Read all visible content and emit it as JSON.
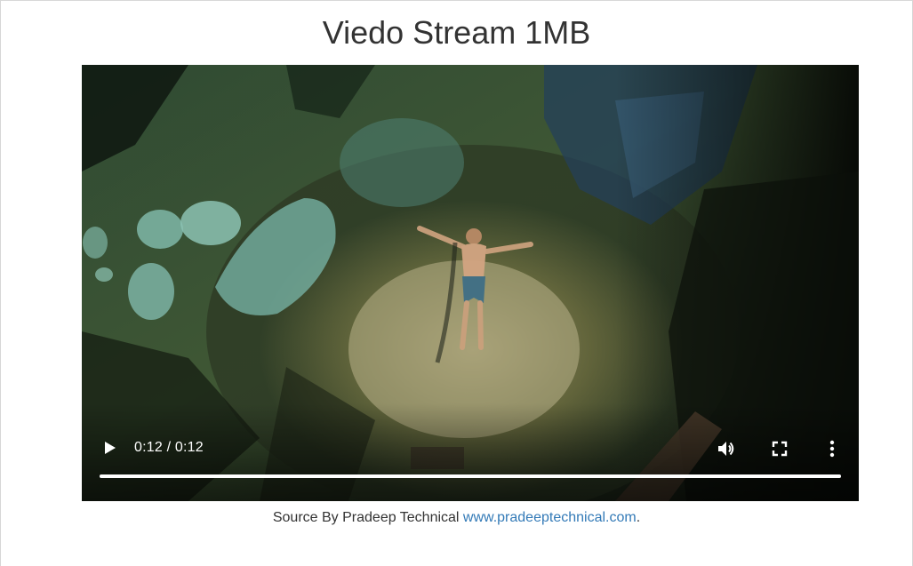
{
  "page": {
    "title": "Viedo Stream 1MB"
  },
  "video": {
    "current_time": "0:12",
    "separator": " / ",
    "duration": "0:12",
    "progress_fraction": 1.0,
    "controls": {
      "play_icon": "play-icon",
      "volume_icon": "volume-icon",
      "fullscreen_icon": "fullscreen-icon",
      "menu_icon": "more-vertical-icon"
    }
  },
  "footer": {
    "prefix": "Source By Pradeep Technical ",
    "link_text": "www.pradeeptechnical.com",
    "suffix": "."
  },
  "colors": {
    "title": "#333333",
    "link": "#337ab7",
    "controls": "#ffffff"
  }
}
